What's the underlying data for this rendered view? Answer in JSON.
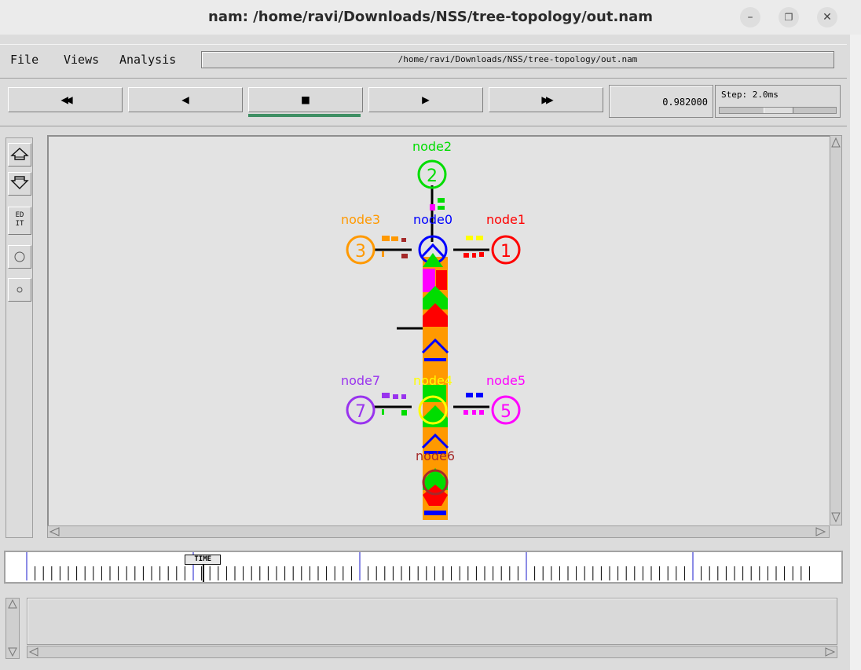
{
  "window": {
    "title": "nam: /home/ravi/Downloads/NSS/tree-topology/out.nam",
    "minimize_glyph": "–",
    "maximize_glyph": "❐",
    "close_glyph": "✕"
  },
  "menu": {
    "items": [
      "File",
      "Views",
      "Analysis"
    ],
    "path": "/home/ravi/Downloads/NSS/tree-topology/out.nam"
  },
  "controls": {
    "rewind_glyph": "◀◀",
    "back_glyph": "◀",
    "stop_glyph": "■",
    "play_glyph": "▶",
    "forward_glyph": "▶▶",
    "time": "0.982000",
    "step_label": "Step: 2.0ms"
  },
  "tools": {
    "edit_label_top": "ED",
    "edit_label_bottom": "IT"
  },
  "timeline": {
    "label": "TIME",
    "position": 0.224
  },
  "nodes": [
    {
      "id": "2",
      "label": "node2",
      "color": "#00dd00"
    },
    {
      "id": "3",
      "label": "node3",
      "color": "#ff9900"
    },
    {
      "id": "0",
      "label": "node0",
      "color": "#0000ff"
    },
    {
      "id": "1",
      "label": "node1",
      "color": "#ff0000"
    },
    {
      "id": "7",
      "label": "node7",
      "color": "#9933ee"
    },
    {
      "id": "4",
      "label": "node4",
      "color": "#ffff00"
    },
    {
      "id": "5",
      "label": "node5",
      "color": "#ff00ff"
    },
    {
      "id": "6",
      "label": "node6",
      "color": "#a52a2a"
    }
  ]
}
